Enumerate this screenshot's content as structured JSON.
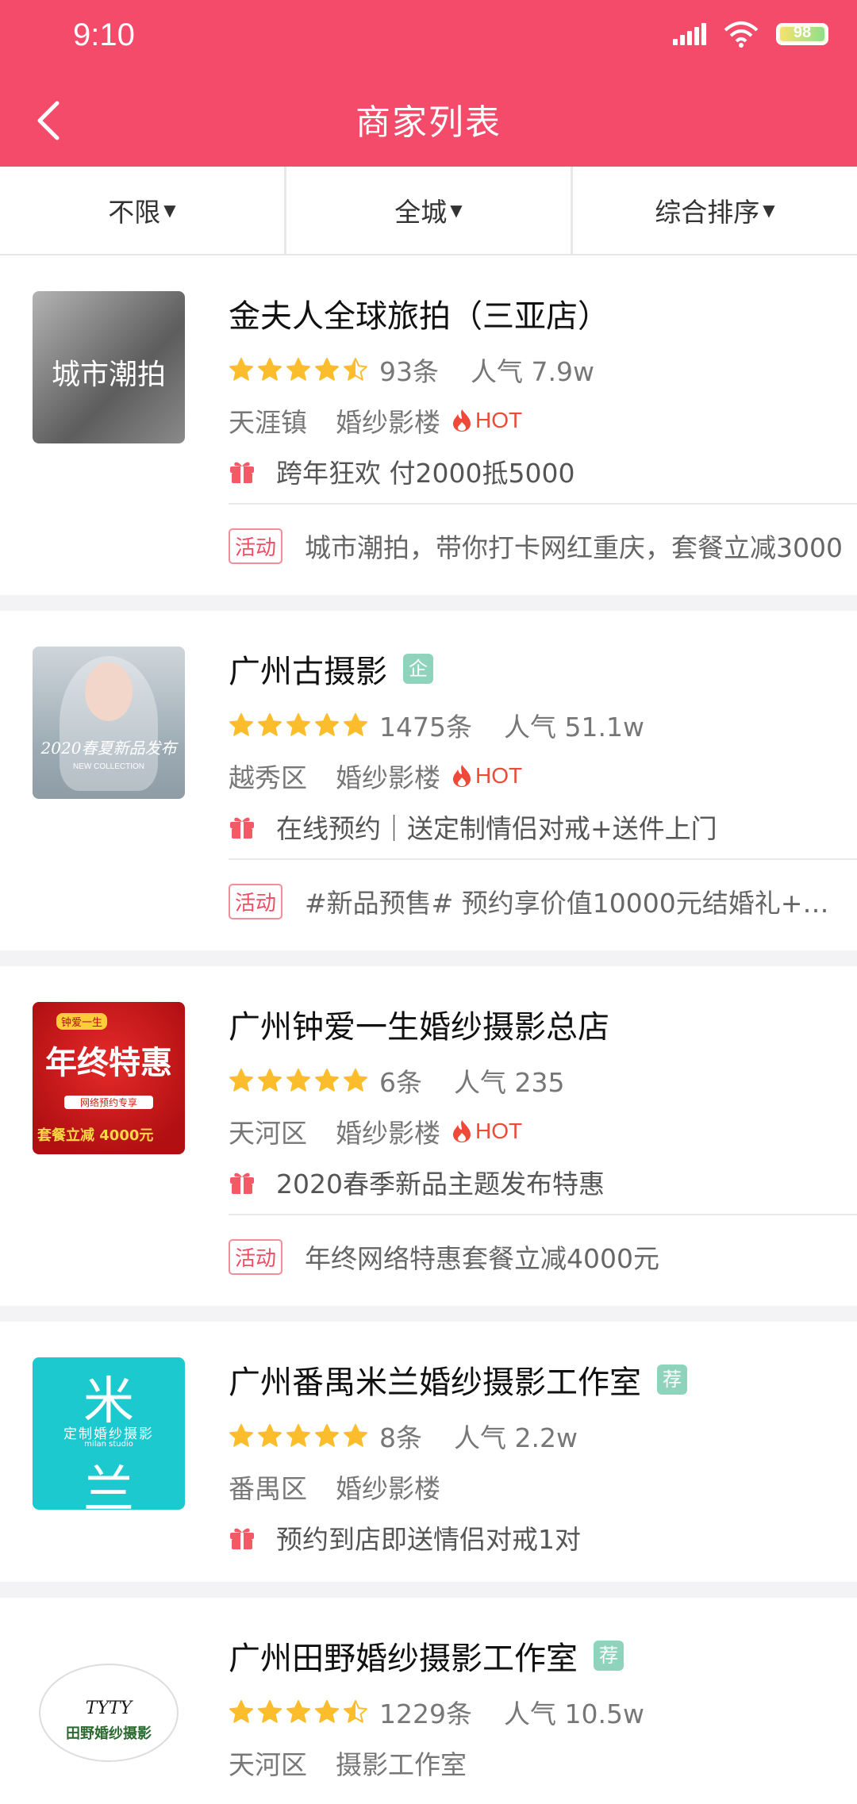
{
  "status_bar": {
    "time": "9:10",
    "battery": "98"
  },
  "nav": {
    "title": "商家列表"
  },
  "filters": [
    {
      "label": "不限"
    },
    {
      "label": "全城"
    },
    {
      "label": "综合排序"
    }
  ],
  "thumbs": {
    "s0": {
      "line1": "城市潮拍"
    },
    "s1": {
      "line1": "2020春夏新品发布",
      "line2": "NEW COLLECTION"
    },
    "s2": {
      "line0": "钟爱一生",
      "line1": "年终特惠",
      "line2": "网络预约专享",
      "line3": "套餐立减 4000元"
    },
    "s3": {
      "c1": "米",
      "c2": "定制婚纱摄影",
      "c3": "milan studio",
      "c4": "兰"
    },
    "s4": {
      "a": "TYTY",
      "b": "田野婚纱摄影"
    }
  },
  "stores": [
    {
      "name": "金夫人全球旅拍（三亚店）",
      "rating": 4.5,
      "reviews": "93条",
      "popularity": "人气 7.9w",
      "district": "天涯镇",
      "category": "婚纱影楼",
      "hot": "HOT",
      "gift": "跨年狂欢 付2000抵5000",
      "activity_label": "活动",
      "activity": "城市潮拍，带你打卡网红重庆，套餐立减3000"
    },
    {
      "name": "广州古摄影",
      "tag": "企",
      "rating": 5,
      "reviews": "1475条",
      "popularity": "人气 51.1w",
      "district": "越秀区",
      "category": "婚纱影楼",
      "hot": "HOT",
      "gift": "在线预约｜送定制情侣对戒+送件上门",
      "activity_label": "活动",
      "activity": "#新品预售# 预约享价值10000元结婚礼+全新..."
    },
    {
      "name": "广州钟爱一生婚纱摄影总店",
      "rating": 5,
      "reviews": "6条",
      "popularity": "人气 235",
      "district": "天河区",
      "category": "婚纱影楼",
      "hot": "HOT",
      "gift": "2020春季新品主题发布特惠",
      "activity_label": "活动",
      "activity": "年终网络特惠套餐立减4000元"
    },
    {
      "name": "广州番禺米兰婚纱摄影工作室",
      "tag": "荐",
      "rating": 5,
      "reviews": "8条",
      "popularity": "人气 2.2w",
      "district": "番禺区",
      "category": "婚纱影楼",
      "gift": "预约到店即送情侣对戒1对"
    },
    {
      "name": "广州田野婚纱摄影工作室",
      "tag": "荐",
      "rating": 4.5,
      "reviews": "1229条",
      "popularity": "人气 10.5w",
      "district": "天河区",
      "category": "摄影工作室"
    }
  ],
  "colors": {
    "brand": "#f44b6b",
    "star": "#fbbd2c",
    "hot": "#ee4a3a",
    "tag": "#8fd3bd"
  }
}
